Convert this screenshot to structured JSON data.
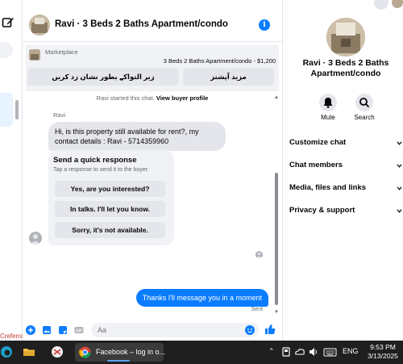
{
  "left_rail": {
    "footer_text": "Creferra"
  },
  "header": {
    "title": "Ravi · 3 Beds 2 Baths Apartment/condo",
    "info_glyph": "i"
  },
  "marketplace": {
    "label": "Marketplace",
    "listing": "3 Beds 2 Baths Apartment/condo - $1,200",
    "primary_action": "زیر التواکے بطور نشان زد کریں",
    "secondary_action": "مزید آپشنز"
  },
  "conversation": {
    "started_prefix": "Ravi started this chat.",
    "view_profile": "View buyer profile",
    "sender_name": "Ravi",
    "incoming_message": "Hi, is this property still available for rent?, my contact details : Ravi - 5714359960",
    "quick_response": {
      "title": "Send a quick response",
      "subtitle": "Tap a response to send it to the buyer.",
      "options": [
        "Yes, are you interested?",
        "In talks. I'll let you know.",
        "Sorry, it's not available."
      ]
    },
    "outgoing_message": "Thanks I'll message you in a moment",
    "outgoing_status": "Sent"
  },
  "composer": {
    "placeholder": "Aa"
  },
  "info_panel": {
    "name": "Ravi · 3 Beds 2 Baths Apartment/condo",
    "actions": [
      {
        "label": "Mute",
        "icon": "bell-icon"
      },
      {
        "label": "Search",
        "icon": "search-icon"
      }
    ],
    "sections": [
      "Customize chat",
      "Chat members",
      "Media, files and links",
      "Privacy & support"
    ]
  },
  "taskbar": {
    "active_task": "Facebook – log in o...",
    "language": "ENG",
    "time": "9:53 PM",
    "date": "3/13/2025"
  },
  "colors": {
    "accent": "#0a7cff",
    "bubble_in": "#e4e6eb",
    "taskbar": "#1f1f1f"
  }
}
